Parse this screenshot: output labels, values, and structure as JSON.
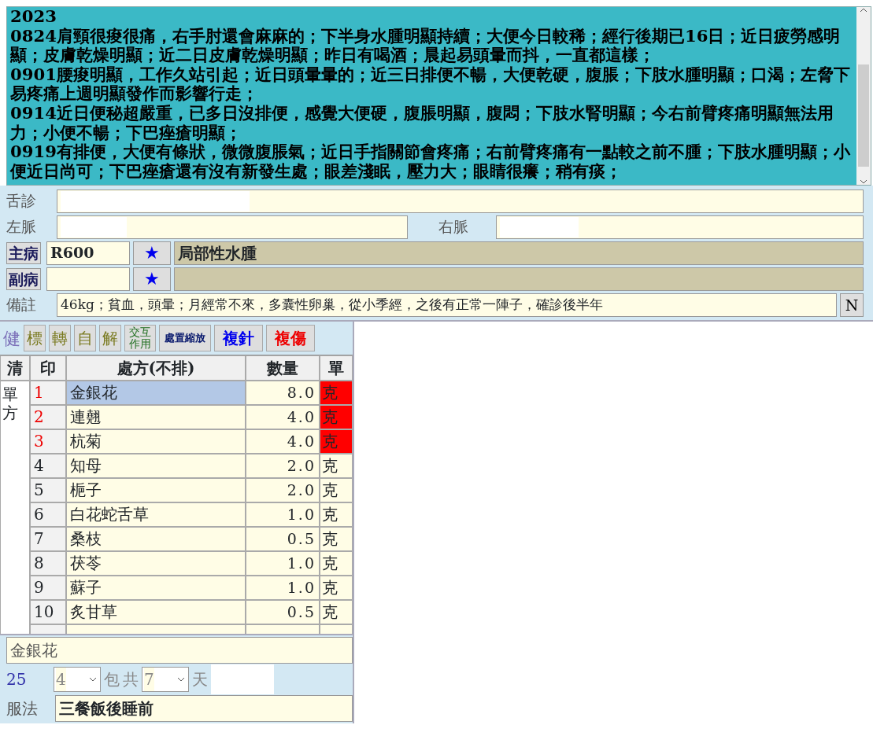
{
  "notes": {
    "lines": [
      "2023",
      "0824肩頸很痠很痛，右手肘還會麻麻的；下半身水腫明顯持續；大便今日較稀；經行後期已16日；近日疲勞感明顯；皮膚乾燥明顯；近二日皮膚乾燥明顯；昨日有喝酒；晨起易頭暈而抖，一直都這樣；",
      "0901腰痠明顯，工作久站引起；近日頭暈暈的；近三日排便不暢，大便乾硬，腹脹；下肢水腫明顯；口渴；左脅下易疼痛上週明顯發作而影響行走；",
      "0914近日便秘超嚴重，已多日沒排便，感覺大便硬，腹脹明顯，腹悶；下肢水腎明顯；今右前臂疼痛明顯無法用力；小便不暢；下巴痤瘡明顯；",
      "0919有排便，大便有條狀，微微腹脹氣；近日手指關節會疼痛；右前臂疼痛有一點較之前不腫；下肢水腫明顯；小便近日尚可；下巴痤瘡還有沒有新發生處；眼差淺眠，壓力大；眼睛很癢；稍有痰；"
    ]
  },
  "tongue": {
    "label": "舌診"
  },
  "pulse": {
    "left_label": "左脈",
    "right_label": "右脈"
  },
  "diagnoses": [
    {
      "label": "主病",
      "code": "R600",
      "star": "★",
      "name": "局部性水腫"
    },
    {
      "label": "副病",
      "star": "★"
    }
  ],
  "remark": {
    "label": "備註",
    "value": "46kg；貧血，頭暈；月經常不來，多囊性卵巢，從小季經，之後有正常一陣子，確診後半年",
    "button": "N"
  },
  "toolbar": [
    {
      "label": "健",
      "kind": "plain",
      "color": "#7b6fb8"
    },
    {
      "label": "標",
      "kind": "box",
      "color": "#7a7a20"
    },
    {
      "label": "轉",
      "kind": "box",
      "color": "#7a7a20"
    },
    {
      "label": "自",
      "kind": "box",
      "color": "#7a7a20"
    },
    {
      "label": "解",
      "kind": "box",
      "color": "#7a7a20"
    },
    {
      "label": "交互作用",
      "kind": "small",
      "color": "#1f6e1f"
    },
    {
      "label": "處置縮放",
      "kind": "bold",
      "color": "#0a1a6e"
    },
    {
      "label": "複針",
      "kind": "bold",
      "color": "#0000ee"
    },
    {
      "label": "複傷",
      "kind": "bold",
      "color": "#ee0000"
    }
  ],
  "table": {
    "columns": [
      "清",
      "印",
      "處方(不排)",
      "數量",
      "單"
    ],
    "side_label": "單方",
    "rows": [
      {
        "index": "1",
        "name": "金銀花",
        "qty": "8.0",
        "unit": "克",
        "flagged": true,
        "selected": true
      },
      {
        "index": "2",
        "name": "連翹",
        "qty": "4.0",
        "unit": "克",
        "flagged": true,
        "selected": false
      },
      {
        "index": "3",
        "name": "杭菊",
        "qty": "4.0",
        "unit": "克",
        "flagged": true,
        "selected": false
      },
      {
        "index": "4",
        "name": "知母",
        "qty": "2.0",
        "unit": "克",
        "flagged": false,
        "selected": false
      },
      {
        "index": "5",
        "name": "梔子",
        "qty": "2.0",
        "unit": "克",
        "flagged": false,
        "selected": false
      },
      {
        "index": "6",
        "name": "白花蛇舌草",
        "qty": "1.0",
        "unit": "克",
        "flagged": false,
        "selected": false
      },
      {
        "index": "7",
        "name": "桑枝",
        "qty": "0.5",
        "unit": "克",
        "flagged": false,
        "selected": false
      },
      {
        "index": "8",
        "name": "茯苓",
        "qty": "1.0",
        "unit": "克",
        "flagged": false,
        "selected": false
      },
      {
        "index": "9",
        "name": "蘇子",
        "qty": "1.0",
        "unit": "克",
        "flagged": false,
        "selected": false
      },
      {
        "index": "10",
        "name": "炙甘草",
        "qty": "0.5",
        "unit": "克",
        "flagged": false,
        "selected": false
      }
    ]
  },
  "detail": {
    "herb": "金銀花",
    "count": "25",
    "packs": "4",
    "packs_unit": "包",
    "total_label": "共",
    "days": "7",
    "days_unit": "天",
    "usage_label": "服法",
    "usage": "三餐飯後睡前"
  }
}
